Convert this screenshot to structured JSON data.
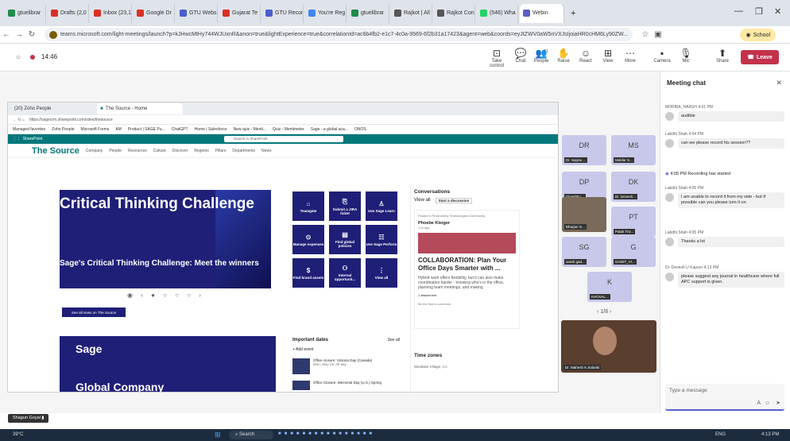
{
  "browser": {
    "tabs": [
      {
        "label": "gtuelibrar",
        "color": "#1f8b4c"
      },
      {
        "label": "Drafts (2,0",
        "color": "#d93025"
      },
      {
        "label": "Inbox (23,1",
        "color": "#d93025"
      },
      {
        "label": "Google Dr",
        "color": "#d93025"
      },
      {
        "label": "GTU Webs",
        "color": "#4a5fd1"
      },
      {
        "label": "Gujarat Te",
        "color": "#d93025"
      },
      {
        "label": "GTU Recon",
        "color": "#4a5fd1"
      },
      {
        "label": "You're Reg",
        "color": "#4285f4"
      },
      {
        "label": "gtuelibrar",
        "color": "#1f8b4c"
      },
      {
        "label": "Rajkot | All",
        "color": "#555"
      },
      {
        "label": "Rajkot Con",
        "color": "#555"
      },
      {
        "label": "(546) Wha",
        "color": "#25d366"
      },
      {
        "label": "Webin",
        "color": "#5b5fc7"
      }
    ],
    "url": "teams.microsoft.com/light-meetings/launch?p=kJHwcMtHy744WJUxnR&anon=true&lightExperience=true&correlationId=ac6b4fb2-e1c7-4c0a-9569-6f2b31a17423&agent=web&coords=eyJtZWV0aW5nVXJsIjoiaHR0cHM6Ly90ZW...",
    "profile": "School"
  },
  "meeting": {
    "timer": "14:46",
    "controls": [
      {
        "label": "Take control",
        "icon": "take-control-icon",
        "glyph": "⊡"
      },
      {
        "label": "Chat",
        "icon": "chat-icon",
        "glyph": "💬"
      },
      {
        "label": "People",
        "icon": "people-icon",
        "glyph": "👥",
        "badge": "71"
      },
      {
        "label": "Raise",
        "icon": "raise-hand-icon",
        "glyph": "✋"
      },
      {
        "label": "React",
        "icon": "react-icon",
        "glyph": "☺"
      },
      {
        "label": "View",
        "icon": "view-icon",
        "glyph": "⊞"
      },
      {
        "label": "More",
        "icon": "more-icon",
        "glyph": "⋯"
      },
      {
        "label": "Camera",
        "icon": "camera-icon",
        "glyph": "▪"
      },
      {
        "label": "Mic",
        "icon": "mic-icon",
        "glyph": "🎙"
      },
      {
        "label": "Share",
        "icon": "share-icon",
        "glyph": "⬆"
      }
    ],
    "leave": "Leave"
  },
  "shared": {
    "tab1": "(20) Zoho People",
    "tab2": "The Source - Home",
    "url": "https://sagecrm.sharepoint.com/sites/thesource",
    "favorites": [
      "Managed favorites",
      "Zoho People",
      "Microsoft Forms",
      "AM",
      "Product | SAGE Pu...",
      "ChatGPT",
      "Home | Salesforce",
      "New quiz - Menti...",
      "Quiz - Mentimeter",
      "Sage - a global aca...",
      "ONOS"
    ],
    "sp_label": "SharePoint",
    "sp_search": "Search in SharePoint",
    "brand": "The Source",
    "nav": [
      "Company",
      "People",
      "Resources",
      "Culture",
      "Discover",
      "Regions",
      "Pillars",
      "Departments",
      "News"
    ],
    "hero_title": "Critical Thinking Challenge",
    "hero_sub": "Sage's Critical Thinking Challenge: Meet the winners",
    "see_all": "See all news on The Source",
    "tiles": [
      "Teamgate",
      "Submit a JIRA ticket",
      "Use Sage Learn",
      "Manage expenses",
      "Find global policies",
      "Use Sage Perform",
      "Find brand assets",
      "Internal opportunit...",
      "View all"
    ],
    "conv_title": "Conversations",
    "conv_view_all": "View all",
    "conv_start": "Start a discussion",
    "conv_posted": "Posted in Productivity Technologies Community",
    "conv_author": "Phoebe Kleiger",
    "conv_time": "1 hr ago",
    "conv_headline": "COLLABORATION: Plan Your Office Days Smarter with ...",
    "conv_body": "Hybrid work offers flexibility, but it can also make coordination harder - knowing who's in the office, planning team meetings, and making",
    "conv_attach": "1 attachment",
    "conv_first": "Be the first to comment",
    "dates_title": "Important dates",
    "dates_see_all": "See all",
    "dates_add": "Add event",
    "date1": "Office closure: Victoria Day (Canada)",
    "date1_sub": "Mon, May 19, All day",
    "date2": "Office Closure: Memorial Day (U.S.) Spring",
    "sage_title": "Sage",
    "sage_sub": "Global Company",
    "tz_title": "Time zones",
    "tz_place": "Westlake Village, CA"
  },
  "participants": [
    {
      "initials": "DR",
      "name": "Dr. Sapna ..."
    },
    {
      "initials": "MS",
      "name": "Meldar S..."
    },
    {
      "initials": "DP",
      "name": "Dipeshku..."
    },
    {
      "initials": "DK",
      "name": "Dr. Devesh..."
    },
    {
      "initials": "",
      "name": "Bharjan G..."
    },
    {
      "initials": "PT",
      "name": "Palak Triv..."
    },
    {
      "initials": "SG",
      "name": "sarah gad..."
    },
    {
      "initials": "G",
      "name": "GAMIT_VI..."
    },
    {
      "initials": "K",
      "name": "KHOVAL..."
    }
  ],
  "pager": "1/8",
  "presenter": "Dr. Mahesh K.Solanki",
  "chat": {
    "title": "Meeting chat",
    "messages": [
      {
        "author": "MORBIA_HARSH",
        "time": "4:01 PM",
        "text": "audible"
      },
      {
        "author": "Labdhi Shah",
        "time": "4:04 PM",
        "text": "can we please record his session??"
      },
      {
        "author": "",
        "time": "4:05 PM",
        "text": "Recording has started"
      },
      {
        "author": "Labdhi Shah",
        "time": "4:05 PM",
        "text": "I am unable to record it from my side - but if possible can you please turn it on"
      },
      {
        "author": "Labdhi Shah",
        "time": "4:05 PM",
        "text": "Thanks a lot"
      },
      {
        "author": "Dr. Devesh U Kapoor",
        "time": "4:13 PM",
        "text": "please suggest any journal in healthcare where full APC support is given."
      }
    ],
    "placeholder": "Type a message"
  },
  "presenting_user": "Shagun Goyal",
  "taskbar": {
    "weather": "39°C",
    "search": "Search",
    "lang": "ENG",
    "time": "4:13 PM"
  }
}
